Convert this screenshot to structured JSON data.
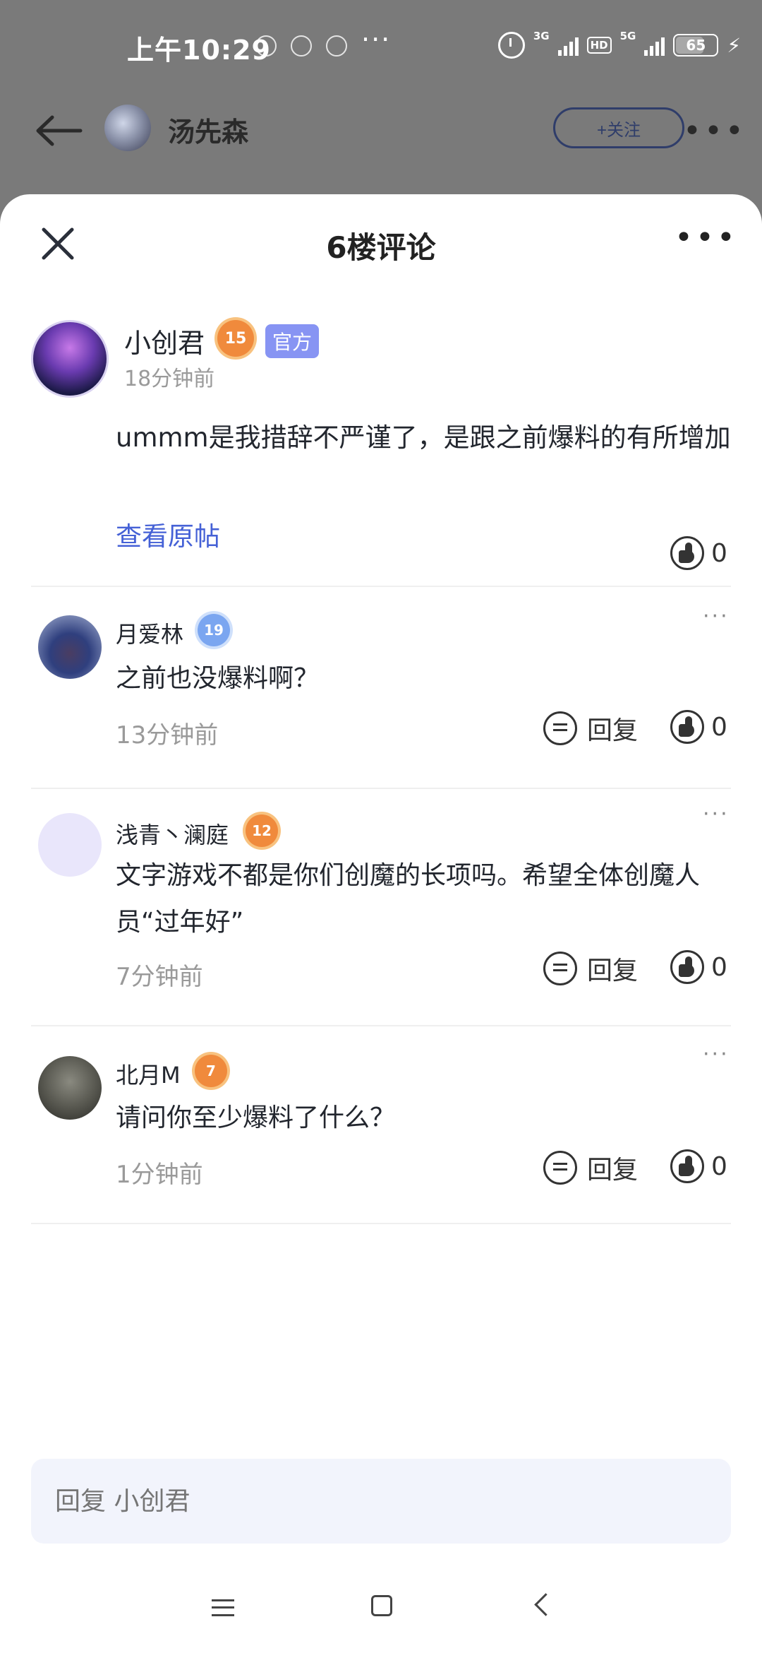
{
  "status_bar": {
    "time": "上午10:29",
    "dots": "···",
    "network_3g": "3G",
    "hd": "HD",
    "network_5g": "5G",
    "battery": "65"
  },
  "post_header": {
    "author": "汤先森",
    "follow_label": "+关注",
    "more": "•••"
  },
  "sheet": {
    "title": "6楼评论",
    "more": "•••"
  },
  "main_comment": {
    "name": "小创君",
    "level": "15",
    "official_badge": "官方",
    "time": "18分钟前",
    "content": "ummm是我措辞不严谨了，是跟之前爆料的有所增加",
    "view_original": "查看原帖",
    "likes": "0"
  },
  "replies": [
    {
      "name": "月爱林",
      "level": "19",
      "content": "之前也没爆料啊？",
      "time": "13分钟前",
      "reply_label": "回复",
      "likes": "0",
      "more": "···"
    },
    {
      "name": "浅青丶澜庭",
      "level": "12",
      "content": "文字游戏不都是你们创魔的长项吗。希望全体创魔人员“过年好”",
      "time": "7分钟前",
      "reply_label": "回复",
      "likes": "0",
      "more": "···"
    },
    {
      "name": "北月M",
      "level": "7",
      "content": "请问你至少爆料了什么？",
      "time": "1分钟前",
      "reply_label": "回复",
      "likes": "0",
      "more": "···"
    }
  ],
  "reply_input": {
    "placeholder": "回复 小创君"
  },
  "colors": {
    "accent_link": "#4561d6",
    "official_badge": "#8794f3",
    "level_orange": "#f08a3c",
    "level_blue": "#7ba6f0"
  }
}
